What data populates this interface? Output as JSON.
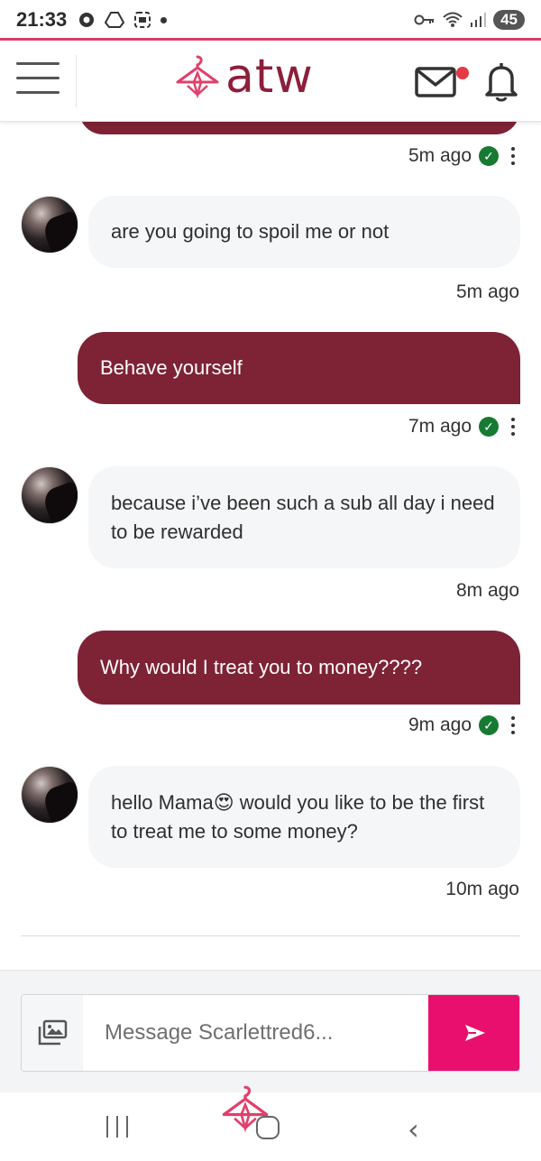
{
  "status_bar": {
    "time": "21:33",
    "battery": "45"
  },
  "header": {
    "logo_text": "atw",
    "icons": [
      "menu-icon",
      "hanger-logo-icon",
      "mail-icon",
      "bell-icon"
    ],
    "brand_color": "#8c1f3a",
    "notification_dot_color": "#e53945"
  },
  "messages": [
    {
      "direction": "outgoing",
      "text": "",
      "time": "5m ago",
      "read": true
    },
    {
      "direction": "incoming",
      "text": "are you going to spoil me or not",
      "time": "5m ago"
    },
    {
      "direction": "outgoing",
      "text": "Behave yourself",
      "time": "7m ago",
      "read": true
    },
    {
      "direction": "incoming",
      "text": "because i’ve been such a sub all day i need to be rewarded",
      "time": "8m ago"
    },
    {
      "direction": "outgoing",
      "text": "Why would I treat you to money????",
      "time": "9m ago",
      "read": true
    },
    {
      "direction": "incoming",
      "text": "hello Mama😍 would you like to be the first to treat me to some money?",
      "time": "10m ago"
    }
  ],
  "composer": {
    "placeholder": "Message Scarlettred6...",
    "value": "",
    "send_color": "#e90f6e"
  },
  "colors": {
    "outgoing_bubble": "#7e2236",
    "incoming_bubble": "#f5f6f8",
    "read_check": "#177a33"
  }
}
